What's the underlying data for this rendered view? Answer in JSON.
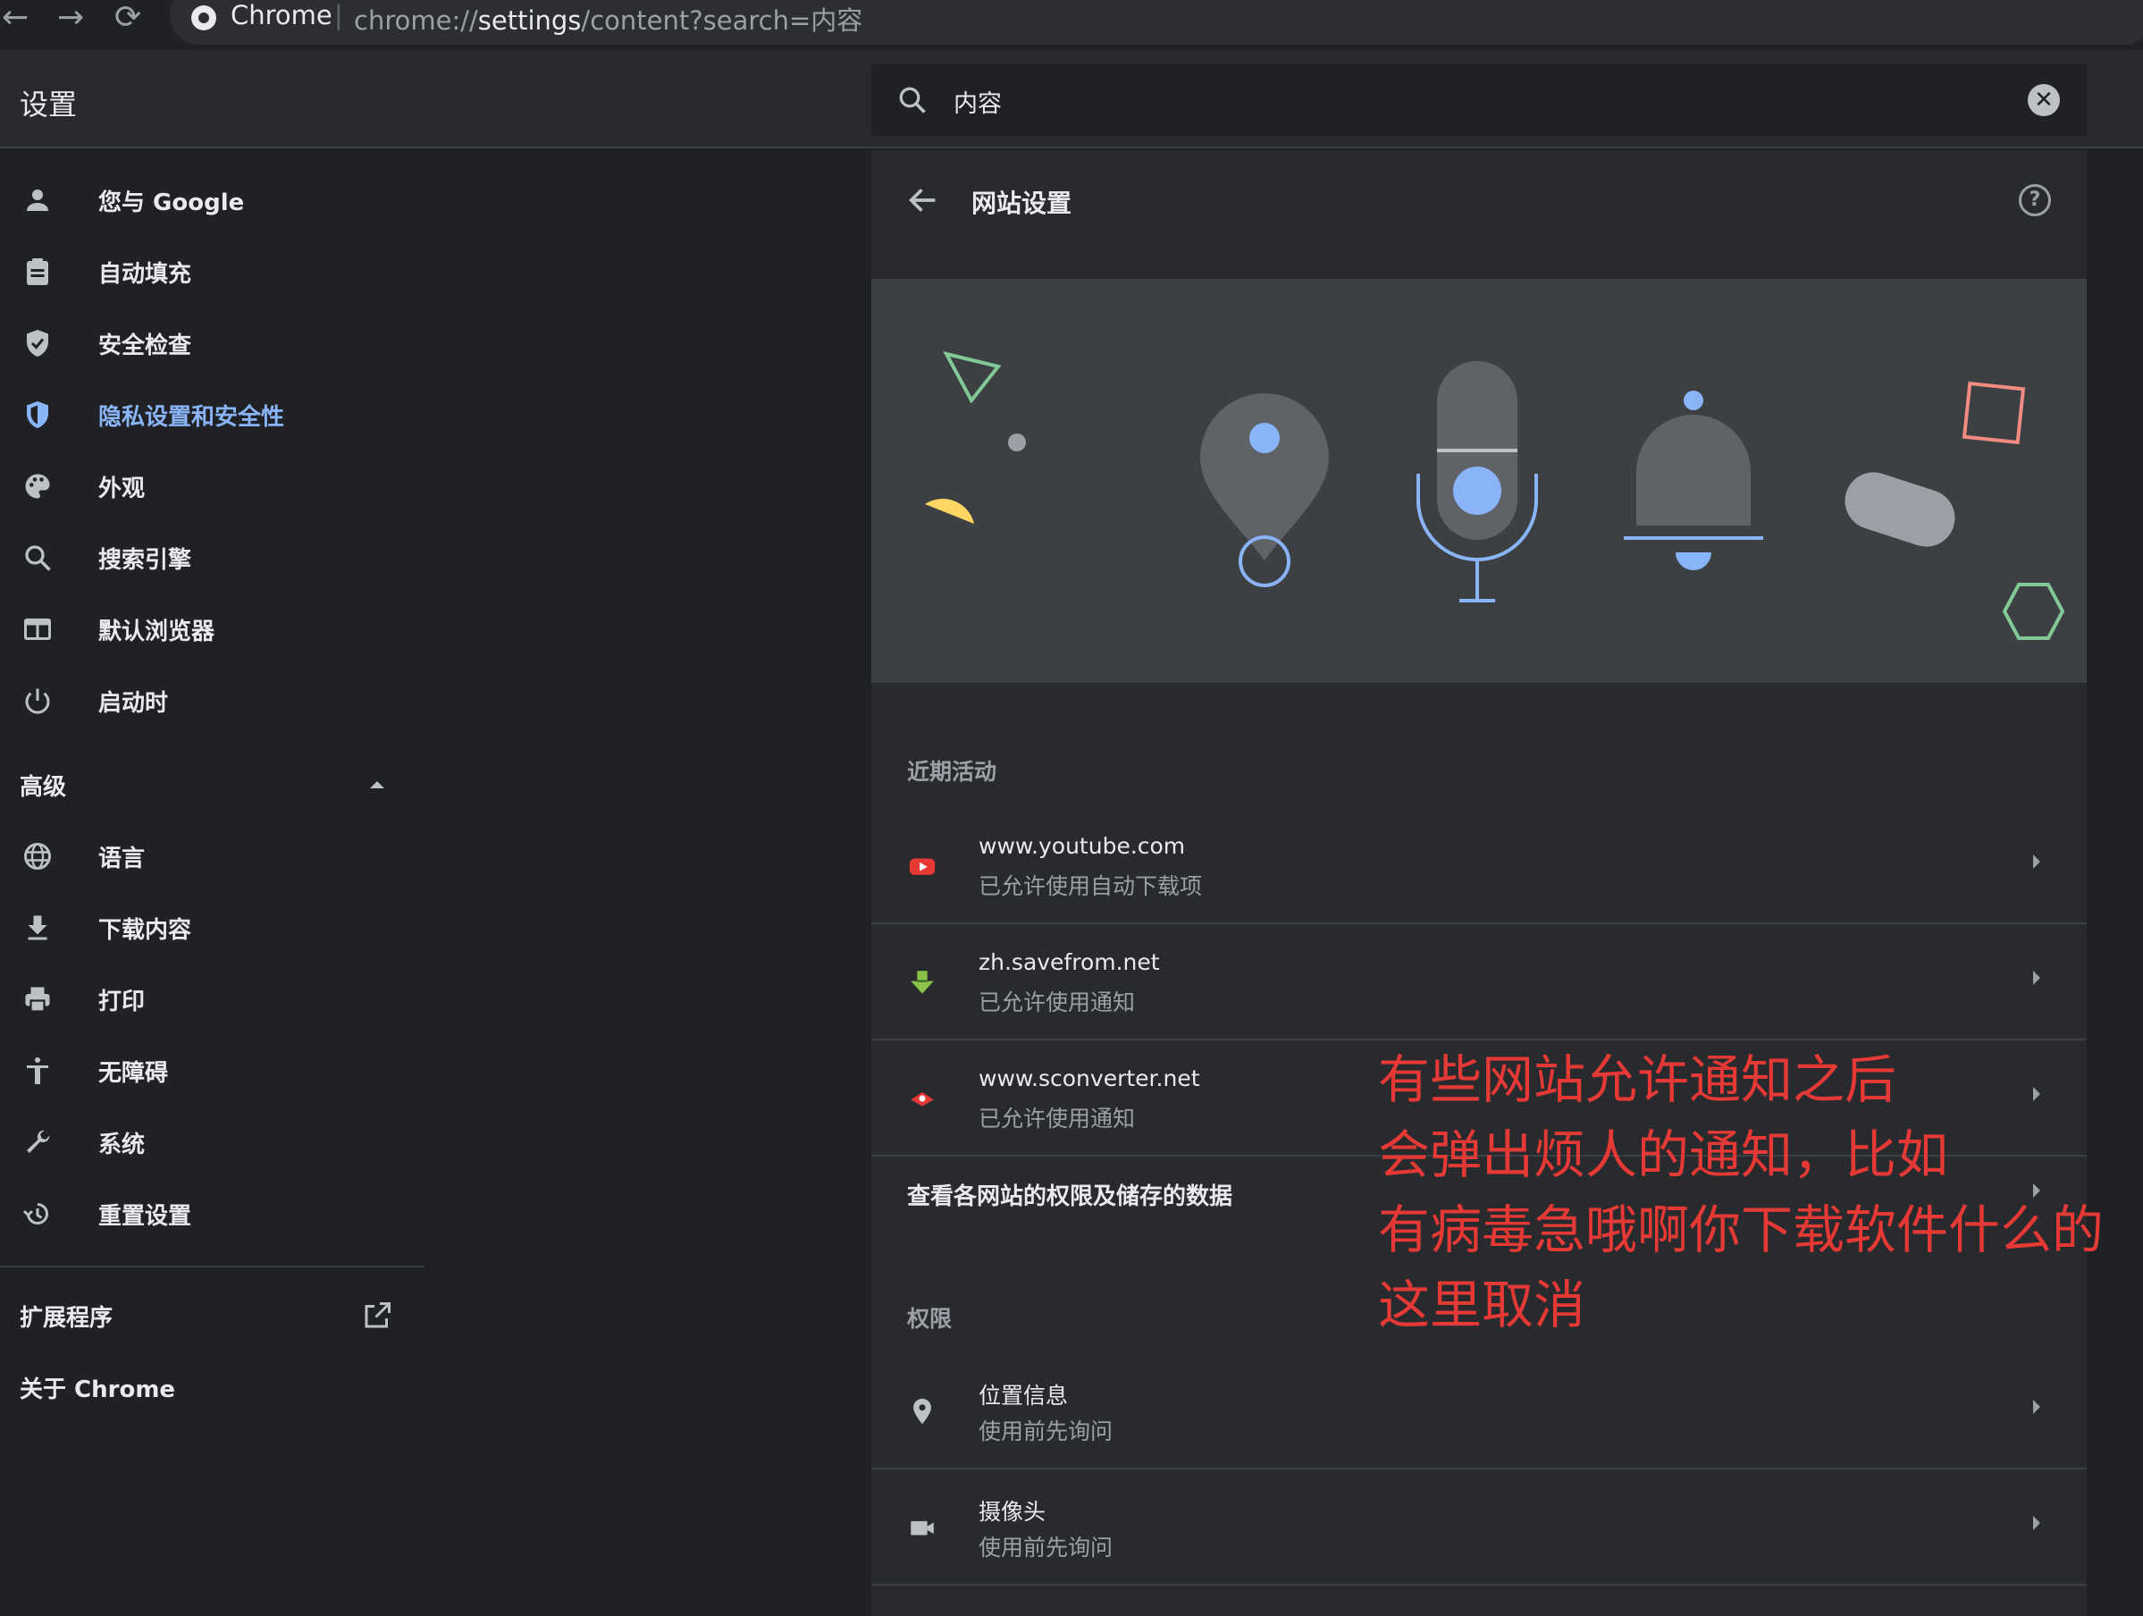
{
  "browser": {
    "back": "←",
    "forward": "→",
    "reload": "⟳",
    "app_name": "Chrome",
    "separator": "|",
    "url_scheme": "chrome://",
    "url_host": "settings",
    "url_path": "/content?search=内容"
  },
  "header": {
    "title": "设置",
    "search_value": "内容",
    "clear": "✕"
  },
  "sidebar": {
    "items": [
      {
        "label": "您与 Google",
        "icon": "person-icon"
      },
      {
        "label": "自动填充",
        "icon": "clipboard-icon"
      },
      {
        "label": "安全检查",
        "icon": "shield-check-icon"
      },
      {
        "label": "隐私设置和安全性",
        "icon": "shield-icon",
        "active": true
      },
      {
        "label": "外观",
        "icon": "palette-icon"
      },
      {
        "label": "搜索引擎",
        "icon": "search-icon"
      },
      {
        "label": "默认浏览器",
        "icon": "browser-icon"
      },
      {
        "label": "启动时",
        "icon": "power-icon"
      }
    ],
    "advanced_label": "高级",
    "advanced_items": [
      {
        "label": "语言",
        "icon": "globe-icon"
      },
      {
        "label": "下载内容",
        "icon": "download-icon"
      },
      {
        "label": "打印",
        "icon": "printer-icon"
      },
      {
        "label": "无障碍",
        "icon": "accessibility-icon"
      },
      {
        "label": "系统",
        "icon": "wrench-icon"
      },
      {
        "label": "重置设置",
        "icon": "history-icon"
      }
    ],
    "extensions_label": "扩展程序",
    "about_label": "关于 Chrome"
  },
  "main": {
    "title": "网站设置",
    "recent_heading": "近期活动",
    "recent": [
      {
        "site": "www.youtube.com",
        "status": "已允许使用自动下载项",
        "icon": "youtube-icon"
      },
      {
        "site": "zh.savefrom.net",
        "status": "已允许使用通知",
        "icon": "savefrom-icon"
      },
      {
        "site": "www.sconverter.net",
        "status": "已允许使用通知",
        "icon": "sconverter-icon"
      }
    ],
    "view_all": "查看各网站的权限及储存的数据",
    "permissions_heading": "权限",
    "permissions": [
      {
        "title": "位置信息",
        "status": "使用前先询问",
        "icon": "location-icon"
      },
      {
        "title": "摄像头",
        "status": "使用前先询问",
        "icon": "camera-icon"
      }
    ]
  },
  "annotation": {
    "lines": [
      "有些网站允许通知之后",
      "会弹出烦人的通知，比如",
      "有病毒急哦啊你下载软件什么的",
      "这里取消"
    ],
    "color": "#e53935"
  }
}
